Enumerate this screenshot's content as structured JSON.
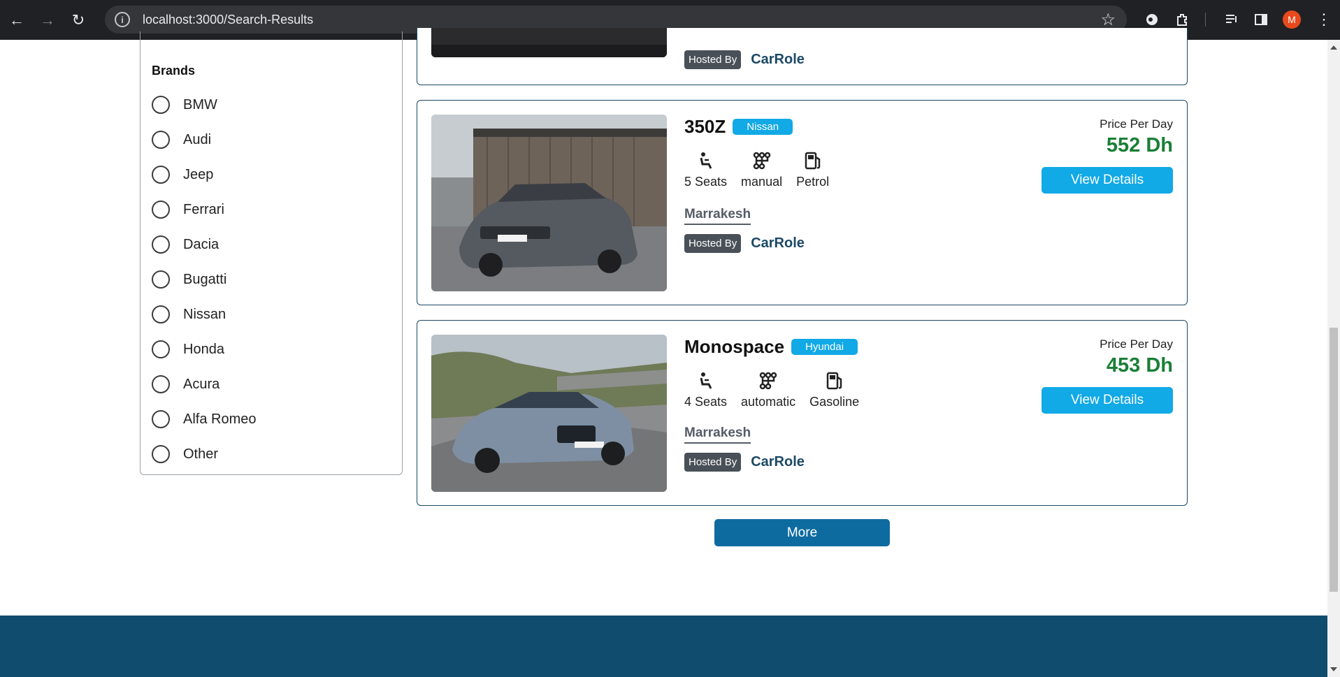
{
  "browser": {
    "url": "localhost:3000/Search-Results",
    "profile_initial": "M"
  },
  "sidebar": {
    "title": "Brands",
    "brands": [
      "BMW",
      "Audi",
      "Jeep",
      "Ferrari",
      "Dacia",
      "Bugatti",
      "Nissan",
      "Honda",
      "Acura",
      "Alfa Romeo",
      "Other"
    ]
  },
  "cards": [
    {
      "hosted_by_label": "Hosted By",
      "host": "CarRole"
    },
    {
      "name": "350Z",
      "brand": "Nissan",
      "seats": "5 Seats",
      "transmission": "manual",
      "fuel": "Petrol",
      "city": "Marrakesh",
      "hosted_by_label": "Hosted By",
      "host": "CarRole",
      "price_label": "Price Per Day",
      "price": "552 Dh",
      "button": "View Details"
    },
    {
      "name": "Monospace",
      "brand": "Hyundai",
      "seats": "4 Seats",
      "transmission": "automatic",
      "fuel": "Gasoline",
      "city": "Marrakesh",
      "hosted_by_label": "Hosted By",
      "host": "CarRole",
      "price_label": "Price Per Day",
      "price": "453 Dh",
      "button": "View Details"
    }
  ],
  "more_button": "More",
  "colors": {
    "accent": "#11a9e6",
    "primary": "#1b4965",
    "price": "#1a7f37",
    "footer": "#0f4c6e"
  }
}
